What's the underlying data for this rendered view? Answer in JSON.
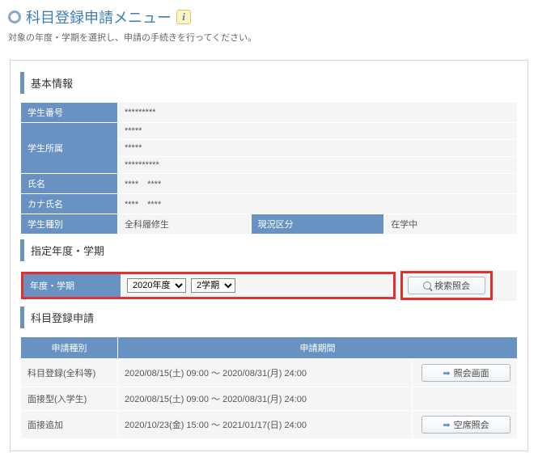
{
  "header": {
    "title": "科目登録申請メニュー",
    "subtitle": "対象の年度・学期を選択し、申請の手続きを行ってください。"
  },
  "basic_info": {
    "heading": "基本情報",
    "rows": {
      "student_no_label": "学生番号",
      "student_no_value": "*********",
      "affiliation_label": "学生所属",
      "affiliation_line1": "*****",
      "affiliation_line2": "*****",
      "affiliation_line3": "**********",
      "name_label": "氏名",
      "name_value": "****　****",
      "kana_label": "カナ氏名",
      "kana_value": "****　****",
      "type_label": "学生種別",
      "type_value": "全科履修生",
      "status_label": "現況区分",
      "status_value": "在学中"
    }
  },
  "term_select": {
    "heading": "指定年度・学期",
    "label": "年度・学期",
    "year_options": [
      "2020年度"
    ],
    "year_selected": "2020年度",
    "term_options": [
      "2学期"
    ],
    "term_selected": "2学期",
    "search_button": "検索照会"
  },
  "applications": {
    "heading": "科目登録申請",
    "col_type": "申請種別",
    "col_period": "申請期間",
    "rows": [
      {
        "type": "科目登録(全科等)",
        "period": "2020/08/15(土) 09:00 ～ 2020/08/31(月) 24:00",
        "action": "照会画面"
      },
      {
        "type": "面接型(入学生)",
        "period": "2020/08/15(土) 09:00 ～ 2020/08/31(月) 24:00",
        "action": ""
      },
      {
        "type": "面接追加",
        "period": "2020/10/23(金) 15:00 ～ 2021/01/17(日) 24:00",
        "action": "空席照会"
      }
    ]
  }
}
